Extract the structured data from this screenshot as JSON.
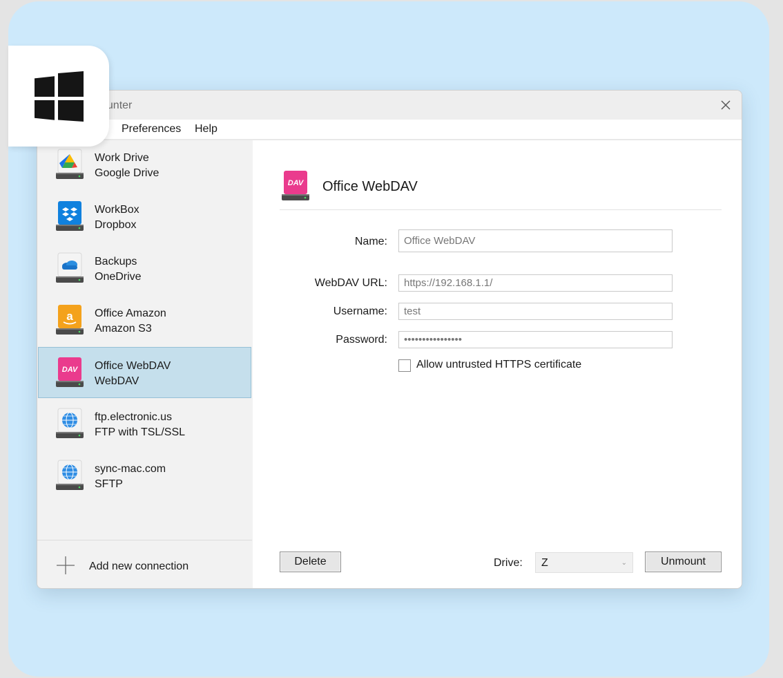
{
  "window": {
    "title": "ounter"
  },
  "menu": {
    "items": [
      "Preferences",
      "Help"
    ]
  },
  "connections": [
    {
      "name": "Work Drive",
      "type": "Google Drive",
      "icon": "google-drive-icon"
    },
    {
      "name": "WorkBox",
      "type": "Dropbox",
      "icon": "dropbox-icon"
    },
    {
      "name": "Backups",
      "type": "OneDrive",
      "icon": "onedrive-icon"
    },
    {
      "name": "Office Amazon",
      "type": "Amazon S3",
      "icon": "amazon-s3-icon"
    },
    {
      "name": "Office WebDAV",
      "type": "WebDAV",
      "icon": "webdav-icon",
      "selected": true
    },
    {
      "name": "ftp.electronic.us",
      "type": "FTP with TSL/SSL",
      "icon": "globe-icon"
    },
    {
      "name": "sync-mac.com",
      "type": "SFTP",
      "icon": "globe-icon"
    }
  ],
  "sidebar": {
    "add_label": "Add new connection"
  },
  "detail": {
    "title": "Office WebDAV",
    "icon_text": "DAV",
    "name_label": "Name:",
    "name_value": "Office WebDAV",
    "url_label": "WebDAV URL:",
    "url_value": "https://192.168.1.1/",
    "username_label": "Username:",
    "username_value": "test",
    "password_label": "Password:",
    "password_value": "••••••••••••••••",
    "checkbox_label": "Allow untrusted HTTPS certificate",
    "checkbox_checked": false
  },
  "footer": {
    "delete_label": "Delete",
    "drive_label": "Drive:",
    "drive_value": "Z",
    "unmount_label": "Unmount"
  },
  "colors": {
    "background": "#cde9fb",
    "selection": "#c5dfec",
    "webdav": "#ea3b8d",
    "amazon": "#f4a21c",
    "dropbox": "#1081de",
    "onedrive": "#1a73c8",
    "globe": "#2f8de4"
  }
}
